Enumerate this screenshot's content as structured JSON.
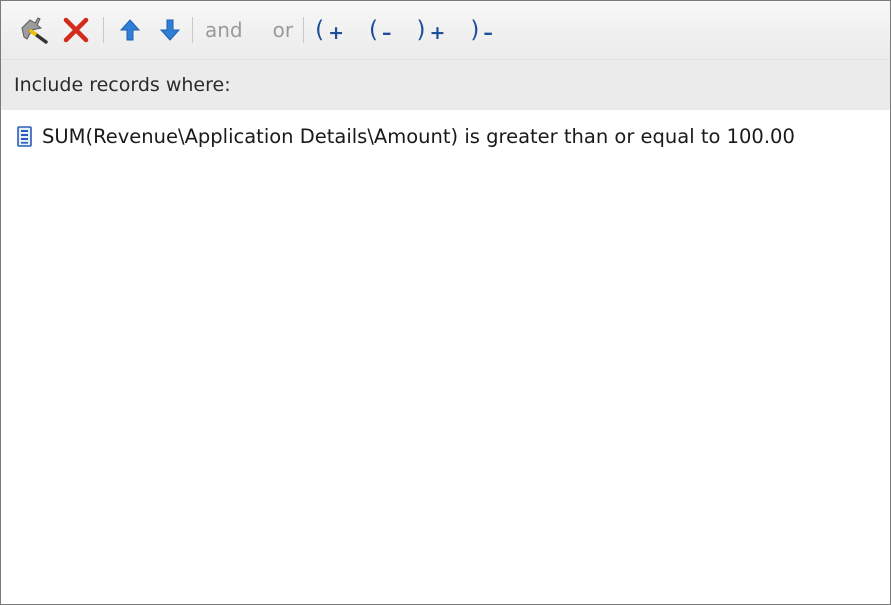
{
  "toolbar": {
    "wizard_icon": "wand-icon",
    "delete_icon": "red-x-icon",
    "move_up_icon": "arrow-up-icon",
    "move_down_icon": "arrow-down-icon",
    "and_label": "and",
    "or_label": "or",
    "add_open_paren": {
      "paren": "(",
      "mark": "+"
    },
    "remove_open_paren": {
      "paren": "(",
      "mark": "–"
    },
    "add_close_paren": {
      "paren": ")",
      "mark": "+"
    },
    "remove_close_paren": {
      "paren": ")",
      "mark": "–"
    }
  },
  "header": {
    "label": "Include records where:"
  },
  "criteria": [
    {
      "icon": "document-icon",
      "text": "SUM(Revenue\\Application Details\\Amount) is greater than or equal to 100.00"
    }
  ],
  "colors": {
    "paren_blue": "#1f4e9b",
    "delete_red": "#d42a1b",
    "disabled_gray": "#9a9a9a",
    "arrow_blue": "#2f7fd8"
  }
}
